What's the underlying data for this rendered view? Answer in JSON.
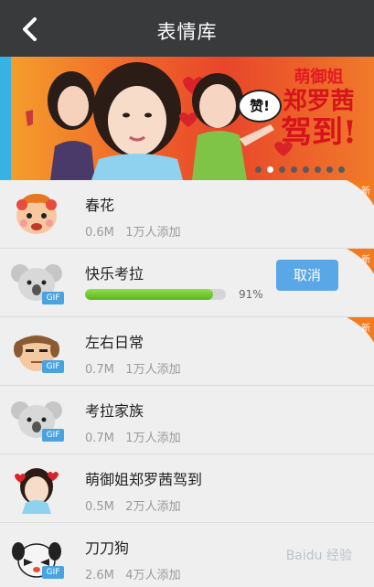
{
  "header": {
    "title": "表情库",
    "back_icon": "back-chevron-icon"
  },
  "banner": {
    "headline_line1": "萌御姐",
    "headline_line2": "郑罗茜",
    "headline_line3": "驾到!",
    "bubble_text": "赞!",
    "dot_count": 8,
    "active_dot": 1
  },
  "items": [
    {
      "name": "春花",
      "size": "0.6M",
      "added": "1万人添加",
      "is_new": true,
      "gif": false
    },
    {
      "name": "快乐考拉",
      "downloading": true,
      "progress": 0.91,
      "progress_label": "91%",
      "cancel_label": "取消",
      "is_new": true,
      "gif": true
    },
    {
      "name": "左右日常",
      "size": "0.7M",
      "added": "1万人添加",
      "is_new": true,
      "gif": true
    },
    {
      "name": "考拉家族",
      "size": "0.7M",
      "added": "1万人添加",
      "is_new": false,
      "gif": true
    },
    {
      "name": "萌御姐郑罗茜驾到",
      "size": "0.5M",
      "added": "2万人添加",
      "is_new": false,
      "gif": false
    },
    {
      "name": "刀刀狗",
      "size": "2.6M",
      "added": "4万人添加",
      "is_new": false,
      "gif": true
    }
  ],
  "labels": {
    "gif": "GIF",
    "new": "新"
  },
  "watermark": "Baidu 经验",
  "colors": {
    "topbar": "#393a3c",
    "accent_blue": "#5aa7e8",
    "progress_green": "#6cc42a",
    "new_orange": "#f47a1c"
  }
}
